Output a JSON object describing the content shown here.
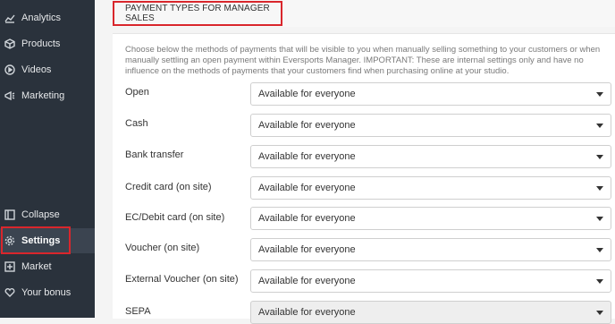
{
  "sidebar": {
    "items": [
      {
        "label": "Analytics",
        "icon": "chart-line-icon"
      },
      {
        "label": "Products",
        "icon": "cube-icon"
      },
      {
        "label": "Videos",
        "icon": "play-circle-icon"
      },
      {
        "label": "Marketing",
        "icon": "megaphone-icon"
      },
      {
        "label": "Collapse",
        "icon": "collapse-icon"
      },
      {
        "label": "Settings",
        "icon": "gear-icon"
      },
      {
        "label": "Market",
        "icon": "plus-square-icon"
      },
      {
        "label": "Your bonus",
        "icon": "heart-icon"
      }
    ]
  },
  "section": {
    "title": "PAYMENT TYPES FOR MANAGER SALES",
    "description": "Choose below the methods of payments that will be visible to you when manually selling something to your customers or when manually settling an open payment within Eversports Manager. IMPORTANT: These are internal settings only and have no influence on the methods of payments that your customers find when purchasing online at your studio."
  },
  "payment_rows": [
    {
      "label": "Open",
      "value": "Available for everyone"
    },
    {
      "label": "Cash",
      "value": "Available for everyone"
    },
    {
      "label": "Bank transfer",
      "value": "Available for everyone"
    },
    {
      "label": "Credit card (on site)",
      "value": "Available for everyone"
    },
    {
      "label": "EC/Debit card (on site)",
      "value": "Available for everyone"
    },
    {
      "label": "Voucher (on site)",
      "value": "Available for everyone"
    },
    {
      "label": "External Voucher (on site)",
      "value": "Available for everyone"
    },
    {
      "label": "SEPA",
      "value": "Available for everyone"
    }
  ],
  "colors": {
    "sidebar": "#2a323c",
    "highlight": "#d9262c"
  }
}
